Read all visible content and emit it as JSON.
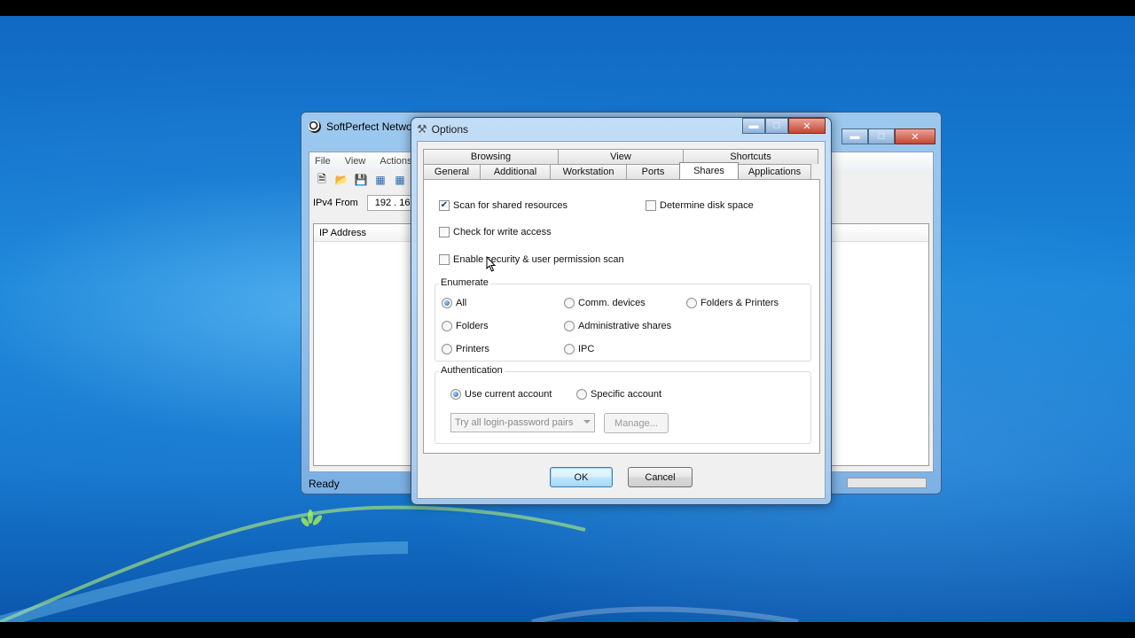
{
  "background_window": {
    "title": "SoftPerfect Networ",
    "menu": [
      "File",
      "View",
      "Actions"
    ],
    "ip_label": "IPv4 From",
    "ip_value": "192 . 16",
    "column_header": "IP Address",
    "status": "Ready"
  },
  "dialog": {
    "title": "Options",
    "tabs_row1": [
      "Browsing",
      "View",
      "Shortcuts"
    ],
    "tabs_row2": [
      "General",
      "Additional",
      "Workstation",
      "Ports",
      "Shares",
      "Applications"
    ],
    "active_tab": "Shares",
    "checkboxes": {
      "scan_shared": {
        "label": "Scan for shared resources",
        "checked": true
      },
      "determine_disk": {
        "label": "Determine disk space",
        "checked": false
      },
      "write_access": {
        "label": "Check for write access",
        "checked": false
      },
      "security_scan": {
        "label": "Enable security & user permission scan",
        "checked": false
      }
    },
    "enumerate": {
      "legend": "Enumerate",
      "options": {
        "all": "All",
        "comm_devices": "Comm. devices",
        "folders_printers": "Folders & Printers",
        "folders": "Folders",
        "admin_shares": "Administrative shares",
        "printers": "Printers",
        "ipc": "IPC"
      },
      "selected": "All"
    },
    "authentication": {
      "legend": "Authentication",
      "use_current": "Use current account",
      "specific": "Specific account",
      "selected": "Use current account",
      "combo_value": "Try all login-password pairs",
      "manage_label": "Manage..."
    },
    "ok_label": "OK",
    "cancel_label": "Cancel"
  },
  "colors": {
    "desktop": "#1a86d8",
    "dialog_frame": "#c3def7",
    "default_button": "#bee6fd"
  }
}
